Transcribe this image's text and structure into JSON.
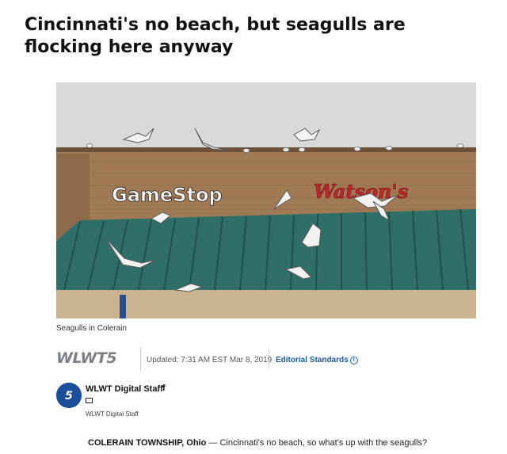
{
  "article": {
    "headline": "Cincinnati's no beach, but seagulls are flocking here anyway",
    "photo": {
      "caption": "Seagulls in Colerain",
      "sign_left": "GameStop",
      "sign_right": "Watson's",
      "alt_icon": "seagulls-photo"
    },
    "byline": {
      "station_logo_text": "WLWT",
      "station_logo_number": "5",
      "updated": "Updated: 7:31 AM EST Mar 8, 2019",
      "editorial_link": "Editorial Standards",
      "editorial_icon": "info-icon"
    },
    "author": {
      "name": "WLWT Digital Staff",
      "social_icon": "facebook-icon",
      "mail_icon": "mail-icon",
      "subtitle": "WLWT Digital Staff"
    },
    "lede": {
      "dateline": "COLERAIN TOWNSHIP, Ohio",
      "dash": " — ",
      "text": "Cincinnati's no beach, so what's up with the seagulls?"
    }
  }
}
